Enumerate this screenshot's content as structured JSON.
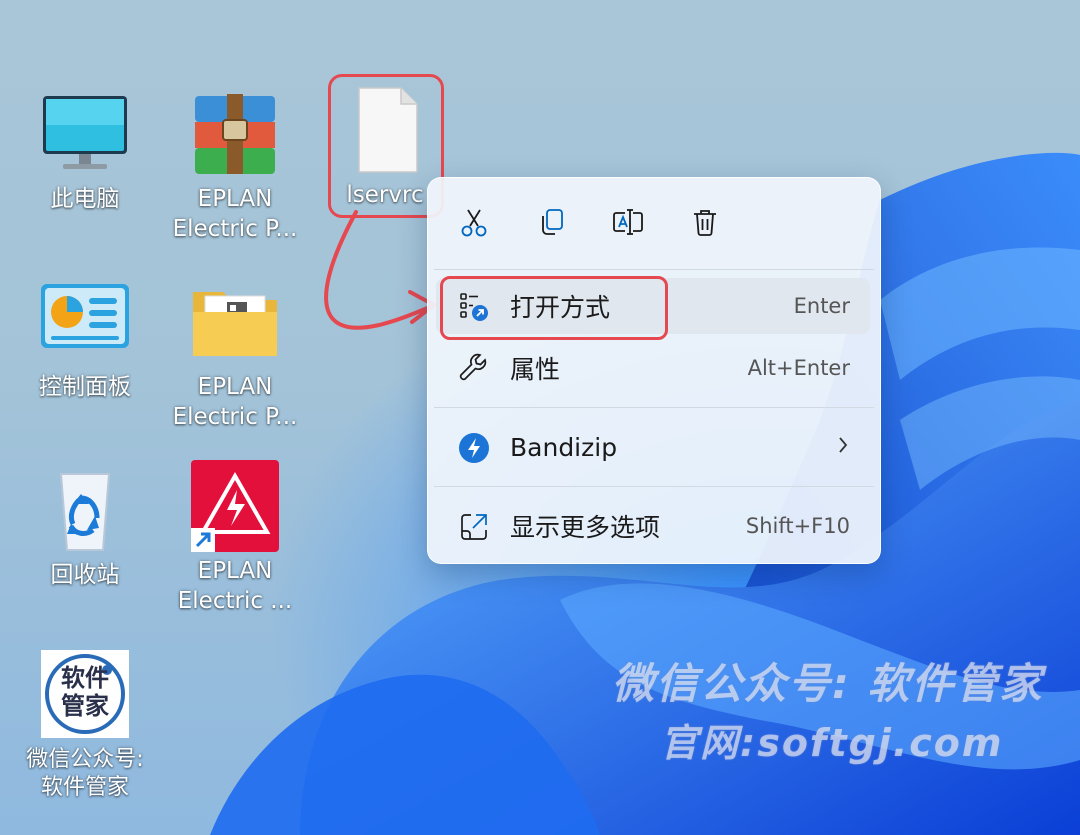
{
  "desktop": {
    "icons": [
      {
        "label": "此电脑",
        "icon": "monitor-icon"
      },
      {
        "label": "EPLAN\nElectric P...",
        "icon": "winrar-archive-icon"
      },
      {
        "label": "lservrc",
        "icon": "blank-file-icon"
      },
      {
        "label": "控制面板",
        "icon": "control-panel-icon"
      },
      {
        "label": "EPLAN\nElectric P...",
        "icon": "folder-icon"
      },
      {
        "label": "回收站",
        "icon": "recycle-bin-icon"
      },
      {
        "label": "EPLAN\nElectric ...",
        "icon": "eplan-shortcut-icon"
      },
      {
        "label": "微信公众号:\n软件管家",
        "icon": "software-manager-logo-icon"
      }
    ]
  },
  "context_menu": {
    "toolbar": [
      "cut-icon",
      "copy-icon",
      "rename-icon",
      "delete-icon"
    ],
    "items": [
      {
        "label": "打开方式",
        "shortcut": "Enter",
        "icon": "open-with-icon"
      },
      {
        "label": "属性",
        "shortcut": "Alt+Enter",
        "icon": "wrench-icon"
      },
      {
        "label": "Bandizip",
        "shortcut": "",
        "icon": "bandizip-icon"
      },
      {
        "label": "显示更多选项",
        "shortcut": "Shift+F10",
        "icon": "show-more-icon"
      }
    ]
  },
  "logo_text": {
    "top": "软件",
    "bottom": "管家"
  },
  "watermark": {
    "line1": "微信公众号: 软件管家",
    "line2": "官网:softgj.com"
  },
  "colors": {
    "highlight": "#e6484f",
    "accent": "#0067c0"
  }
}
